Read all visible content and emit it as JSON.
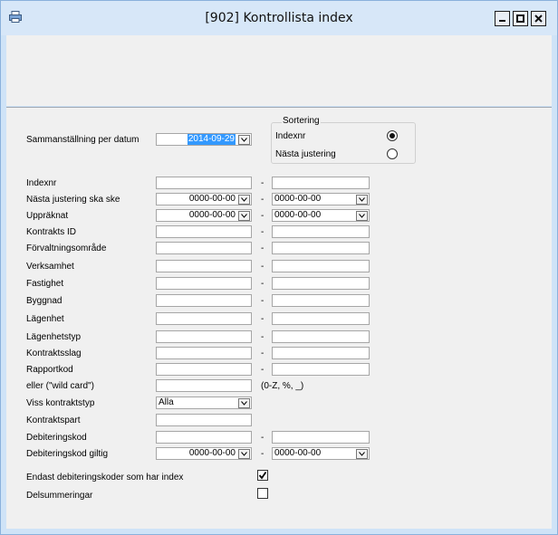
{
  "window": {
    "title": "[902]  Kontrollista index",
    "app_icon": "printer-icon",
    "controls": [
      "minimize-icon",
      "maximize-icon",
      "close-icon"
    ]
  },
  "form": {
    "date_label": "Sammanställning per datum",
    "date_value": "2014-09-29",
    "sorting": {
      "title": "Sortering",
      "options": [
        "Indexnr",
        "Nästa justering"
      ],
      "selected": "Indexnr"
    },
    "range_labels": {
      "indexnr": "Indexnr",
      "next_adjustment": "Nästa justering ska ske",
      "enumerated": "Uppräknat",
      "contract_id": "Kontrakts ID",
      "management_area": "Förvaltningsområde",
      "business": "Verksamhet",
      "property": "Fastighet",
      "building": "Byggnad",
      "apartment": "Lägenhet",
      "apartment_type": "Lägenhetstyp",
      "contract_kind": "Kontraktsslag",
      "report_code": "Rapportkod",
      "wildcard": "eller (\"wild card\")",
      "contract_type": "Viss kontraktstyp",
      "contract_party": "Kontraktspart",
      "billing_code": "Debiteringskod",
      "billing_code_valid": "Debiteringskod giltig"
    },
    "dash": "-",
    "date_placeholder": "0000-00-00",
    "wildcard_hint": "(0-Z, %, _)",
    "contract_type_value": "Alla",
    "checkboxes": {
      "only_index_codes": {
        "label": "Endast debiteringskoder som har index",
        "checked": true
      },
      "subtotals": {
        "label": "Delsummeringar",
        "checked": false
      }
    }
  }
}
